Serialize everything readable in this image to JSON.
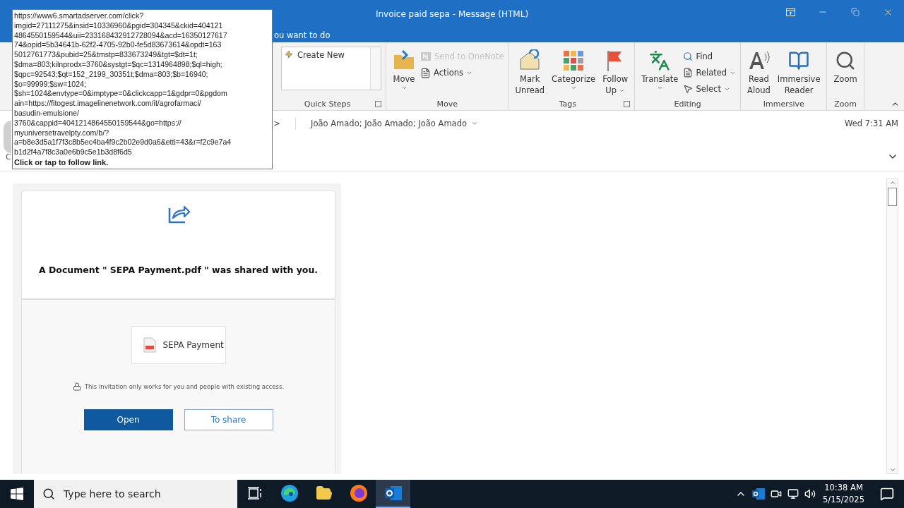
{
  "window": {
    "title": "Invoice paid sepa  -  Message (HTML)"
  },
  "tell_me": {
    "text": "ou want to do"
  },
  "ribbon": {
    "groups": [
      {
        "label": "Quick Steps",
        "launcher": true,
        "items": [
          {
            "kind": "gallery",
            "lines": [
              "Create New"
            ]
          }
        ]
      },
      {
        "label": "Move",
        "launcher": false,
        "items": [
          {
            "kind": "large",
            "lines": [
              "Move"
            ],
            "caret": true,
            "disabled": false
          },
          {
            "kind": "small",
            "lines": [
              "Send to OneNote"
            ],
            "caret": false,
            "disabled": true
          },
          {
            "kind": "small",
            "lines": [
              "Actions"
            ],
            "caret": true,
            "disabled": false
          }
        ]
      },
      {
        "label": "Tags",
        "launcher": true,
        "items": [
          {
            "kind": "large",
            "lines": [
              "Mark",
              "Unread"
            ],
            "caret": false,
            "disabled": false
          },
          {
            "kind": "large",
            "lines": [
              "Categorize"
            ],
            "caret": true,
            "disabled": false
          },
          {
            "kind": "large",
            "lines": [
              "Follow",
              "Up"
            ],
            "caret": true,
            "disabled": false
          }
        ]
      },
      {
        "label": "Editing",
        "launcher": false,
        "items": [
          {
            "kind": "large",
            "lines": [
              "Translate"
            ],
            "caret": true,
            "disabled": false
          },
          {
            "kind": "small",
            "lines": [
              "Find"
            ],
            "caret": false,
            "disabled": false
          },
          {
            "kind": "small",
            "lines": [
              "Related"
            ],
            "caret": true,
            "disabled": false
          },
          {
            "kind": "small",
            "lines": [
              "Select"
            ],
            "caret": true,
            "disabled": false
          }
        ]
      },
      {
        "label": "Immersive",
        "launcher": false,
        "items": [
          {
            "kind": "large",
            "lines": [
              "Read",
              "Aloud"
            ],
            "caret": false,
            "disabled": false
          },
          {
            "kind": "large",
            "lines": [
              "Immersive",
              "Reader"
            ],
            "caret": false,
            "disabled": false
          }
        ]
      },
      {
        "label": "Zoom",
        "launcher": false,
        "items": [
          {
            "kind": "large",
            "lines": [
              "Zoom"
            ],
            "caret": false,
            "disabled": false
          }
        ]
      }
    ]
  },
  "header": {
    "from_marker": ">",
    "recipients": "João Amado; João Amado; João Amado",
    "date": "Wed 7:31 AM",
    "cc_label": "C"
  },
  "tooltip": {
    "url_lines": [
      "https://www6.smartadserver.com/click?",
      "imgid=27111275&insid=10336960&pgid=304345&ckid=404121",
      "4864550159544&uii=233168432912728094&acd=16350127617",
      "74&opid=5b34641b-62f2-4705-92b0-fe5d83673614&opdt=163",
      "5012761773&pubid=25&tmstp=833673249&tgt=$dt=1t;",
      "$dma=803;kilnprodx=3760&systgt=$qc=1314964898;$ql=high;",
      "$qpc=92543;$qt=152_2199_30351t;$dma=803;$b=16940;",
      "$o=99999;$sw=1024;",
      "$sh=1024&envtype=0&imptype=0&clickcapp=1&gdpr=0&pgdom",
      "ain=https://fitogest.imagelinenetwork.com/it/agrofarmaci/",
      "basudin-emulsione/",
      "3760&cappid=4041214864550159544&go=https://",
      "myuniversetravelpty.com/b/?",
      "a=b8e3d5a1f7f3c8b5ec4ba4f9c2b02e9d0a6&etti=43&r=f2c9e7a4",
      "b1d2f4a7f8c3a0e6b9c5e1b3d8f6d5"
    ],
    "hint": "Click or tap to follow link."
  },
  "message": {
    "heading": "A Document \" SEPA Payment.pdf \" was shared with you.",
    "attachment": "SEPA Payment",
    "notice": "This invitation only works for you and people with existing access.",
    "buttons": [
      {
        "kind": "primary",
        "label": "Open"
      },
      {
        "kind": "secondary",
        "label": "To share"
      }
    ]
  },
  "taskbar": {
    "search_placeholder": "Type here to search",
    "apps": [
      {
        "selected": false
      },
      {
        "selected": false
      },
      {
        "selected": false
      },
      {
        "selected": false
      },
      {
        "selected": true
      }
    ],
    "time": "10:38 AM",
    "date": "5/15/2025"
  }
}
